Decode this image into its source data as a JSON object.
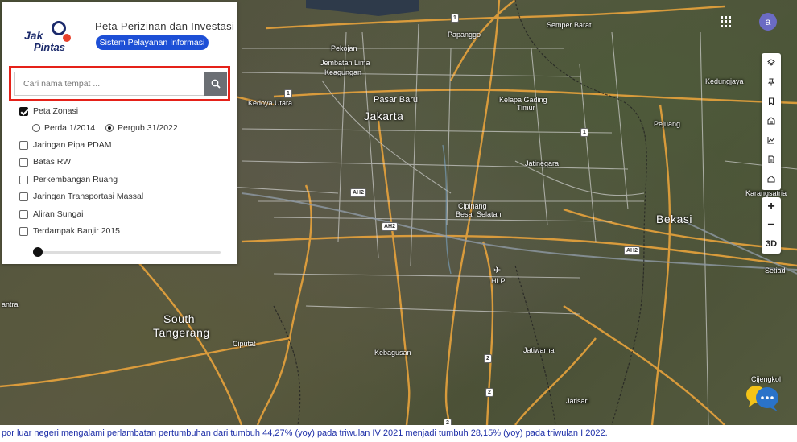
{
  "panel": {
    "logo_line1": "Jak",
    "logo_line2": "Pintas",
    "title": "Peta Perizinan dan Investasi",
    "subtitle": "Sistem Pelayanan Informasi"
  },
  "search": {
    "placeholder": "Cari nama tempat ...",
    "button_icon": "search-icon"
  },
  "layers": {
    "items": [
      {
        "label": "Peta Zonasi",
        "checked": true
      },
      {
        "label": "Jaringan Pipa PDAM",
        "checked": false
      },
      {
        "label": "Batas RW",
        "checked": false
      },
      {
        "label": "Perkembangan Ruang",
        "checked": false
      },
      {
        "label": "Jaringan Transportasi Massal",
        "checked": false
      },
      {
        "label": "Aliran Sungai",
        "checked": false
      },
      {
        "label": "Terdampak Banjir 2015",
        "checked": false
      }
    ],
    "zonasi_options": [
      {
        "label": "Perda 1/2014",
        "selected": false
      },
      {
        "label": "Pergub 31/2022",
        "selected": true
      }
    ],
    "opacity_slider": 0.0
  },
  "map": {
    "labels": {
      "papanggo": "Papanggo",
      "semper_barat": "Semper Barat",
      "pekojan": "Pekojan",
      "jembatan_lima": "Jembatan Lima",
      "keagungan": "Keagungan",
      "pasar_baru": "Pasar Baru",
      "jakarta": "Jakarta",
      "kedoya_utara": "Kedoya Utara",
      "kelapa_gading": "Kelapa Gading",
      "timur": "Timur",
      "pejuang": "Pejuang",
      "kedung": "Kedungjaya",
      "jatinegara": "Jatinegara",
      "cipinang": "Cipinang",
      "besar_selatan": "Besar Selatan",
      "bekasi": "Bekasi",
      "karang": "Karangsatria",
      "setia": "Setiad",
      "hlp": "HLP",
      "south": "South",
      "tangerang": "Tangerang",
      "ciputat": "Ciputat",
      "kebagusan": "Kebagusan",
      "jatiwarna": "Jatiwarna",
      "jatisari": "Jatisari",
      "cijengkol": "Cijengkol",
      "antra": "antra"
    },
    "shields": {
      "ah2_a": "AH2",
      "ah2_b": "AH2",
      "ah2_c": "AH2",
      "r1_a": "1",
      "r1_b": "1",
      "r1_c": "1",
      "r2_a": "2",
      "r2_b": "2",
      "r2_c": "2"
    }
  },
  "controls": {
    "avatar_letter": "a",
    "zoom_in": "+",
    "zoom_out": "−",
    "three_d": "3D"
  },
  "ticker": {
    "text": "por luar negeri mengalami perlambatan pertumbuhan dari tumbuh 44,27% (yoy) pada triwulan IV 2021 menjadi tumbuh 28,15% (yoy) pada triwulan I 2022."
  }
}
